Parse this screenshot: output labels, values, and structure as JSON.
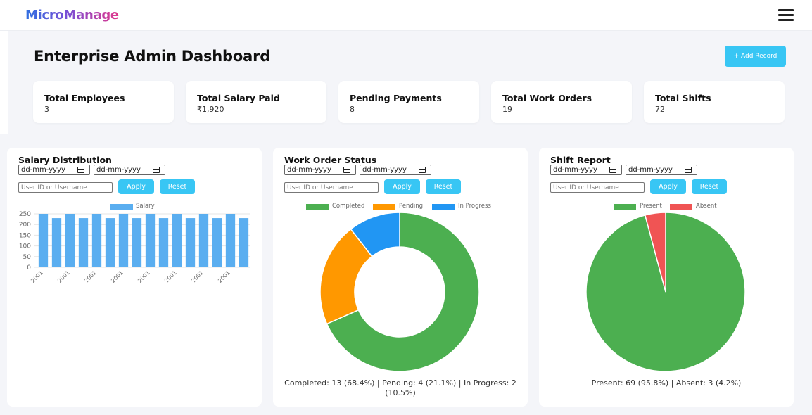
{
  "app": {
    "brand": "MicroManage"
  },
  "header": {
    "title": "Enterprise Admin Dashboard",
    "add_button": "+ Add Record"
  },
  "stats": [
    {
      "label": "Total Employees",
      "value": "3"
    },
    {
      "label": "Total Salary Paid",
      "value": "₹1,920"
    },
    {
      "label": "Pending Payments",
      "value": "8"
    },
    {
      "label": "Total Work Orders",
      "value": "19"
    },
    {
      "label": "Total Shifts",
      "value": "72"
    }
  ],
  "filters": {
    "date_placeholder": "dd-mm-yyyy",
    "user_placeholder": "User ID or Username",
    "apply": "Apply",
    "reset": "Reset"
  },
  "salary": {
    "title": "Salary Distribution",
    "chart_data": {
      "type": "bar",
      "series": [
        {
          "name": "Salary",
          "values": [
            250,
            230,
            250,
            230,
            250,
            230,
            250,
            230,
            250,
            230,
            250,
            230,
            250,
            230,
            250,
            230
          ]
        }
      ],
      "values": [
        250,
        230,
        250,
        230,
        250,
        230,
        250,
        230,
        250,
        230,
        250,
        230,
        250,
        230,
        250,
        230
      ],
      "x_tick_labels": [
        "2001",
        "2001",
        "2001",
        "2001",
        "2001",
        "2001",
        "2001",
        "2001"
      ],
      "y_ticks": [
        "250",
        "200",
        "150",
        "100",
        "50",
        "0"
      ],
      "ylim": [
        0,
        250
      ],
      "color": "#5aaef0",
      "grid": true
    }
  },
  "work_orders": {
    "title": "Work Order Status",
    "chart_data": {
      "type": "pie",
      "donut": true,
      "labels": [
        "Completed",
        "Pending",
        "In Progress"
      ],
      "values": [
        13,
        4,
        2
      ],
      "colors": [
        "#4caf50",
        "#ff9800",
        "#2196f3"
      ]
    },
    "summary": "Completed: 13 (68.4%)  |  Pending: 4 (21.1%)  |  In Progress: 2 (10.5%)"
  },
  "shifts": {
    "title": "Shift Report",
    "chart_data": {
      "type": "pie",
      "donut": false,
      "labels": [
        "Present",
        "Absent"
      ],
      "values": [
        69,
        3
      ],
      "colors": [
        "#4caf50",
        "#f05454"
      ]
    },
    "summary": "Present: 69 (95.8%)  |  Absent: 3 (4.2%)"
  }
}
